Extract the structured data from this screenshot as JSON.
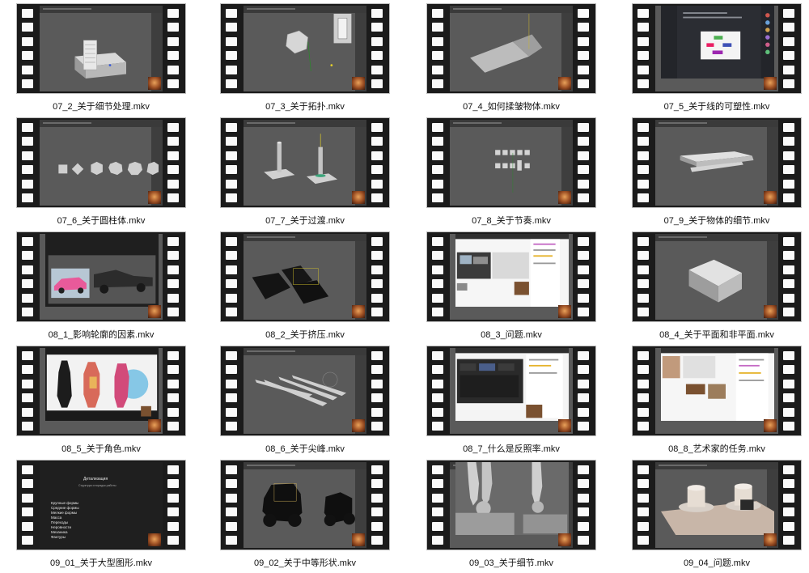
{
  "files": [
    {
      "name": "07_2_关于细节处理.mkv",
      "scene": "box-menu"
    },
    {
      "name": "07_3_关于拓扑.mkv",
      "scene": "hex-lantern"
    },
    {
      "name": "07_4_如何揉皱物体.mkv",
      "scene": "folded-plane"
    },
    {
      "name": "07_5_关于线的可塑性.mkv",
      "scene": "chat-app"
    },
    {
      "name": "07_6_关于圆柱体.mkv",
      "scene": "polygons-row"
    },
    {
      "name": "07_7_关于过渡.mkv",
      "scene": "cylinders-on-plates"
    },
    {
      "name": "07_8_关于节奏.mkv",
      "scene": "cube-grid"
    },
    {
      "name": "07_9_关于物体的细节.mkv",
      "scene": "flat-panels"
    },
    {
      "name": "08_1_影响轮廓的因素.mkv",
      "scene": "car-reference"
    },
    {
      "name": "08_2_关于挤压.mkv",
      "scene": "dark-blocks"
    },
    {
      "name": "08_3_问题.mkv",
      "scene": "video-call"
    },
    {
      "name": "08_4_关于平面和非平面.mkv",
      "scene": "bevel-box"
    },
    {
      "name": "08_5_关于角色.mkv",
      "scene": "character-sheet"
    },
    {
      "name": "08_6_关于尖峰.mkv",
      "scene": "spikes"
    },
    {
      "name": "08_7_什么是反照率.mkv",
      "scene": "dark-apps"
    },
    {
      "name": "08_8_艺术家的任务.mkv",
      "scene": "video-call-2"
    },
    {
      "name": "09_01_关于大型图形.mkv",
      "scene": "slide-list"
    },
    {
      "name": "09_02_关于中等形状.mkv",
      "scene": "silhouettes"
    },
    {
      "name": "09_03_关于细节.mkv",
      "scene": "sculpt"
    },
    {
      "name": "09_04_问题.mkv",
      "scene": "top-hats"
    }
  ],
  "slide": {
    "title": "Детализация",
    "subtitle": "Структура и порядок работы",
    "items": [
      "Крупные формы",
      "Средние формы",
      "Мелкие формы",
      "Масса",
      "Переходы",
      "Неровности",
      "Механика",
      "Фактуры"
    ]
  }
}
